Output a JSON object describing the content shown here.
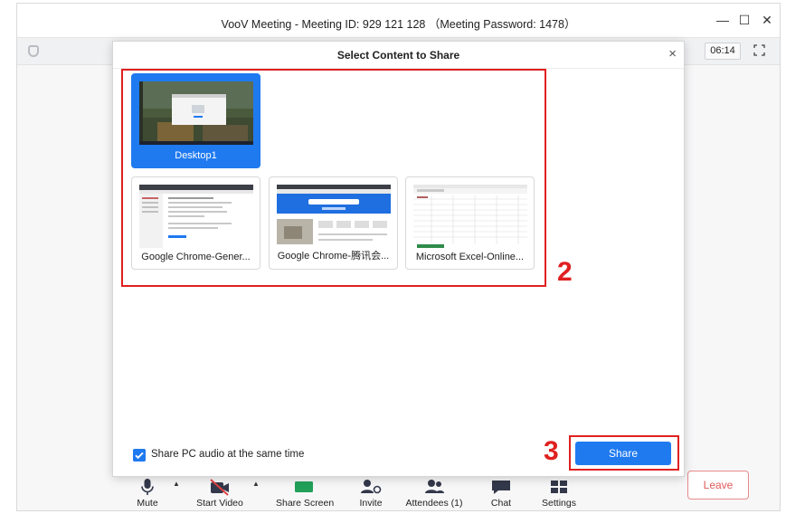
{
  "window": {
    "title": "VooV Meeting - Meeting ID: 929 121 128 （Meeting Password: 1478）",
    "controls": {
      "minimize": "—",
      "maximize": "☐",
      "close": "✕"
    }
  },
  "subbar": {
    "timer": "06:14"
  },
  "dialog": {
    "title": "Select Content to Share",
    "close": "×",
    "items": [
      {
        "label": "Desktop1",
        "selected": true
      },
      {
        "label": "Google Chrome-Gener...",
        "selected": false
      },
      {
        "label": "Google Chrome-腾讯会...",
        "selected": false
      },
      {
        "label": "Microsoft Excel-Online...",
        "selected": false
      }
    ],
    "audio_checkbox": {
      "label": "Share PC audio at the same time",
      "checked": true
    },
    "share_button": "Share"
  },
  "annotations": {
    "step2": "2",
    "step3": "3"
  },
  "toolbar": {
    "items": [
      {
        "label": "Mute",
        "icon": "microphone-icon"
      },
      {
        "label": "Start Video",
        "icon": "video-off-icon"
      },
      {
        "label": "Share Screen",
        "icon": "share-screen-icon"
      },
      {
        "label": "Invite",
        "icon": "invite-icon"
      },
      {
        "label": "Attendees (1)",
        "icon": "attendees-icon"
      },
      {
        "label": "Chat",
        "icon": "chat-icon"
      },
      {
        "label": "Settings",
        "icon": "settings-icon"
      }
    ],
    "leave": "Leave"
  },
  "colors": {
    "accent": "#1f7af0",
    "annotation": "#e02020",
    "leave": "#e15a5a"
  }
}
